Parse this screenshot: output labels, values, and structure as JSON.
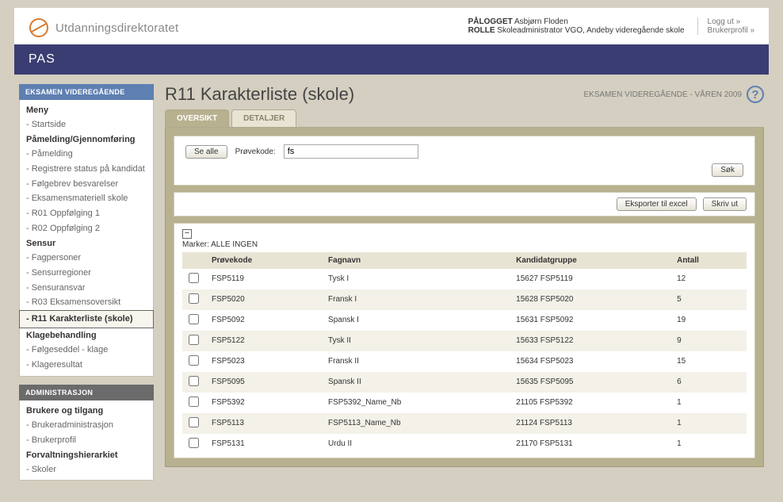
{
  "brand": {
    "name": "Utdanningsdirektoratet"
  },
  "session": {
    "logged_label": "PÅLOGGET",
    "logged_name": "Asbjørn Floden",
    "role_label": "ROLLE",
    "role_value": "Skoleadministrator VGO, Andeby videregående skole",
    "logout": "Logg ut »",
    "profile": "Brukerprofil »"
  },
  "app_bar": "PAS",
  "sidebar": {
    "block1": {
      "header": "EKSAMEN VIDEREGÅENDE",
      "groups": [
        {
          "title": "Meny",
          "items": [
            "- Startside"
          ]
        },
        {
          "title": "Påmelding/Gjennomføring",
          "items": [
            "- Påmelding",
            "- Registrere status på kandidat",
            "- Følgebrev besvarelser",
            "- Eksamensmateriell skole",
            "- R01 Oppfølging 1",
            "- R02 Oppfølging 2"
          ]
        },
        {
          "title": "Sensur",
          "items": [
            "- Fagpersoner",
            "- Sensurregioner",
            "- Sensuransvar",
            "- R03 Eksamensoversikt",
            "- R11 Karakterliste (skole)"
          ]
        },
        {
          "title": "Klagebehandling",
          "items": [
            "- Følgeseddel - klage",
            "- Klageresultat"
          ]
        }
      ]
    },
    "block2": {
      "header": "ADMINISTRASJON",
      "groups": [
        {
          "title": "Brukere og tilgang",
          "items": [
            "- Brukeradministrasjon",
            "- Brukerprofil"
          ]
        },
        {
          "title": "Forvaltningshierarkiet",
          "items": [
            "- Skoler"
          ]
        }
      ]
    }
  },
  "page": {
    "title": "R11 Karakterliste (skole)",
    "context": "EKSAMEN VIDEREGÅENDE - VÅREN 2009"
  },
  "tabs": {
    "oversikt": "OVERSIKT",
    "detaljer": "DETALJER"
  },
  "filter": {
    "see_all": "Se alle",
    "provekode_label": "Prøvekode:",
    "provekode_value": "fs",
    "search": "Søk"
  },
  "actions": {
    "export": "Eksporter til excel",
    "print": "Skriv ut"
  },
  "table": {
    "marker_label": "Marker:",
    "marker_alle": "ALLE",
    "marker_ingen": "INGEN",
    "headers": {
      "provekode": "Prøvekode",
      "fagnavn": "Fagnavn",
      "kandidatgruppe": "Kandidatgruppe",
      "antall": "Antall"
    },
    "rows": [
      {
        "provekode": "FSP5119",
        "fagnavn": "Tysk I",
        "kandidatgruppe": "15627 FSP5119",
        "antall": "12"
      },
      {
        "provekode": "FSP5020",
        "fagnavn": "Fransk I",
        "kandidatgruppe": "15628 FSP5020",
        "antall": "5"
      },
      {
        "provekode": "FSP5092",
        "fagnavn": "Spansk I",
        "kandidatgruppe": "15631 FSP5092",
        "antall": "19"
      },
      {
        "provekode": "FSP5122",
        "fagnavn": "Tysk II",
        "kandidatgruppe": "15633 FSP5122",
        "antall": "9"
      },
      {
        "provekode": "FSP5023",
        "fagnavn": "Fransk II",
        "kandidatgruppe": "15634 FSP5023",
        "antall": "15"
      },
      {
        "provekode": "FSP5095",
        "fagnavn": "Spansk II",
        "kandidatgruppe": "15635 FSP5095",
        "antall": "6"
      },
      {
        "provekode": "FSP5392",
        "fagnavn": "FSP5392_Name_Nb",
        "kandidatgruppe": "21105 FSP5392",
        "antall": "1"
      },
      {
        "provekode": "FSP5113",
        "fagnavn": "FSP5113_Name_Nb",
        "kandidatgruppe": "21124 FSP5113",
        "antall": "1"
      },
      {
        "provekode": "FSP5131",
        "fagnavn": "Urdu II",
        "kandidatgruppe": "21170 FSP5131",
        "antall": "1"
      }
    ]
  }
}
